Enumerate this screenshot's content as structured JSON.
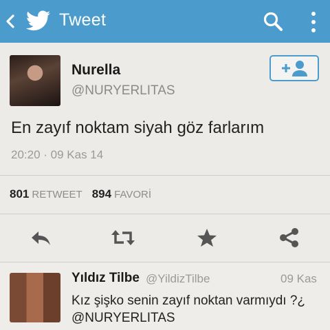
{
  "header": {
    "title": "Tweet",
    "back_icon": "chevron-left-icon",
    "logo_icon": "twitter-bird-icon",
    "search_icon": "search-icon",
    "menu_icon": "more-vertical-icon",
    "color": "#4b9ccd"
  },
  "tweet": {
    "name": "Nurella",
    "handle": "@NURYERLITAS",
    "text": "En zayıf noktam siyah göz farlarım",
    "timestamp": "20:20 · 09 Kas 14",
    "retweet_count": "801",
    "retweet_label": "RETWEET",
    "favorite_count": "894",
    "favorite_label": "FAVORİ",
    "follow_icon": "add-user-icon"
  },
  "actions": [
    "reply-icon",
    "retweet-icon",
    "favorite-star-icon",
    "share-icon"
  ],
  "reply": {
    "name": "Yıldız Tilbe",
    "handle": "@YildizTilbe",
    "date": "09 Kas",
    "text": "Kız şişko senin zayıf noktan varmıydı ?¿ @NURYERLITAS"
  }
}
